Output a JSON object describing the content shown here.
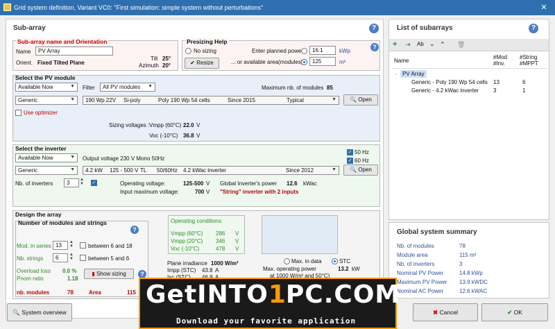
{
  "window": {
    "title": "Grid system definition, Variant VC0:  \"First simulation: simple system without perturbations\"",
    "close": "✕"
  },
  "subarray": {
    "header": "Sub-array",
    "help": "?",
    "name_legend": "Sub-array name and Orientation",
    "name_label": "Name",
    "name_value": "PV Array",
    "orient_label": "Orient.",
    "orient_value": "Fixed Tilted Plane",
    "tilt_label": "Tilt",
    "tilt_value": "25°",
    "azimuth_label": "Azimuth",
    "azimuth_value": "20°"
  },
  "presizing": {
    "legend": "Presizing Help",
    "no_sizing": "No sizing",
    "resize": "Resize",
    "power_label": "Enter planned power",
    "power_value": "16.1",
    "power_unit": "kWp",
    "area_label": "... or available area(modules)",
    "area_value": "125",
    "area_unit": "m²"
  },
  "pv_module": {
    "legend": "Select the PV module",
    "availability": "Available Now",
    "filter_label": "Filter",
    "filter_value": "All PV modules",
    "max_label": "Maximum nb. of modules",
    "max_value": "85",
    "manufacturer": "Generic",
    "power": "190 Wp 22V",
    "tech": "Si-poly",
    "model": "Poly 190 Wp  54 cells",
    "since": "Since 2015",
    "typ": "Typical",
    "open": "Open",
    "optimizer": "Use optimizer",
    "sizing_label": "Sizing voltages :",
    "vmpp_label": "Vmpp (60°C)",
    "vmpp_value": "22.0",
    "vmpp_unit": "V",
    "voc_label": "Voc (-10°C)",
    "voc_value": "36.8",
    "voc_unit": "V"
  },
  "inverter": {
    "legend": "Select the inverter",
    "availability": "Available Now",
    "output": "Output voltage 230 V Mono 50Hz",
    "hz50": "50 Hz",
    "hz60": "60 Hz",
    "manufacturer": "Generic",
    "power": "4.2 kW",
    "range": "125 - 500 V",
    "tl": "TL",
    "freq": "50/60Hz",
    "model": "4.2 kWac inverter",
    "since": "Since 2012",
    "open": "Open",
    "nb_label": "Nb. of inverters",
    "nb_value": "3",
    "op_label": "Operating voltage:",
    "op_value": "125-500",
    "op_unit": "V",
    "gp_label": "Global Inverter's power",
    "gp_value": "12.6",
    "gp_unit": "kWac",
    "maxv_label": "Input maximum voltage:",
    "maxv_value": "700",
    "maxv_unit": "V",
    "string_note": "\"String\" inverter with 2 inputs"
  },
  "design": {
    "legend": "Design the array",
    "sub_legend": "Number of modules and strings",
    "mod_series_label": "Mod. in series",
    "mod_series_value": "13",
    "between1": "between 6 and 18",
    "strings_label": "Nb. strings",
    "strings_value": "6",
    "between2": "between 5 and 6",
    "overload_label": "Overload loss",
    "overload_value": "0.0 %",
    "pnom_label": "Pnom ratio",
    "pnom_value": "1.18",
    "show_sizing": "Show sizing",
    "nb_modules_label": "nb. modules",
    "nb_modules_value": "78",
    "area_label": "Area",
    "area_value": "115",
    "opcond_title": "Operating conditions",
    "vmpp60_label": "Vmpp (60°C)",
    "vmpp60_value": "286",
    "vmpp20_label": "Vmpp (20°C)",
    "vmpp20_value": "346",
    "voc_label": "Voc (-10°C)",
    "voc_value": "478",
    "v_unit": "V",
    "irr_label": "Plane irradiance",
    "irr_value": "1000 W/m²",
    "impp_label": "Impp (STC)",
    "impp_value": "43.8",
    "a_unit": "A",
    "isc_label": "Isc (STC)",
    "isc_value": "46.9",
    "max_in_data": "Max. in data",
    "stc": "STC",
    "maxpow_label": "Max. operating power",
    "maxpow_value": "13.2",
    "maxpow_unit": "kW",
    "at_label": "at 1000 W/m² and 50°C)"
  },
  "list": {
    "header": "List of subarrays",
    "help": "?",
    "col_name": "Name",
    "col_mod": "#Mod\n#Inv.",
    "col_string": "#String\n#MPPT",
    "root": "PV Array",
    "rows": [
      {
        "name": "Generic - Poly 190 Wp  54 cells",
        "a": "13",
        "b": "6"
      },
      {
        "name": "Generic - 4.2 kWac inverter",
        "a": "3",
        "b": "1"
      }
    ]
  },
  "summary": {
    "header": "Global system summary",
    "rows": [
      {
        "label": "Nb. of modules",
        "value": "78"
      },
      {
        "label": "Module area",
        "value": "115 m²"
      },
      {
        "label": "Nb. of inverters",
        "value": "3"
      },
      {
        "label": "Nominal PV Power",
        "value": "14.8  kWp"
      },
      {
        "label": "Maximum PV Power",
        "value": "13.9  kWDC"
      },
      {
        "label": "Nominal AC Power",
        "value": "12.6  kWAC"
      }
    ]
  },
  "footer": {
    "system_overview": "System overview",
    "cancel": "Cancel",
    "ok": "OK"
  },
  "watermark": {
    "brand": "GetINTO",
    "num": "1",
    "brand2": "PC",
    "suffix": ".COM",
    "tagline": "Download your favorite application"
  }
}
